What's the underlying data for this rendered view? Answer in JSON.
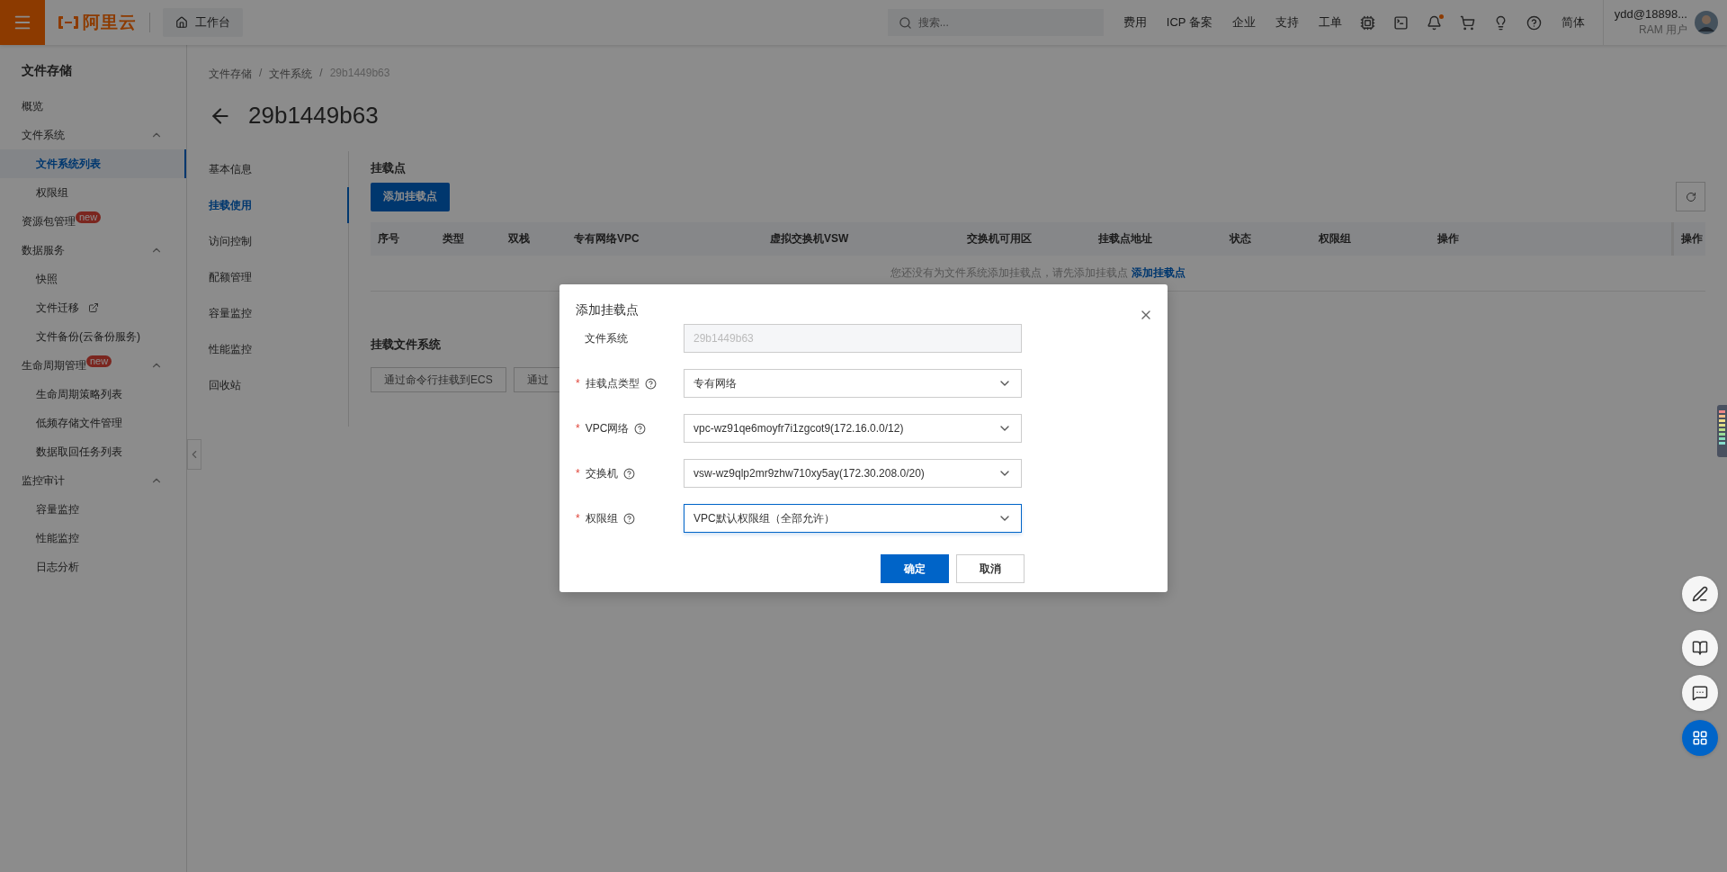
{
  "topbar": {
    "logo": "阿里云",
    "workbench": "工作台",
    "search": {
      "placeholder": "搜索..."
    },
    "links": [
      "费用",
      "ICP 备案",
      "企业",
      "支持",
      "工单"
    ],
    "language": "简体",
    "user": {
      "name": "ydd@18898...",
      "role": "RAM 用户"
    }
  },
  "sidebar": {
    "title": "文件存储",
    "items": [
      {
        "label": "概览",
        "selected": false
      },
      {
        "label": "文件系统",
        "selected": false,
        "expanded": true,
        "children": [
          {
            "label": "文件系统列表",
            "selected": true
          },
          {
            "label": "权限组",
            "selected": false
          }
        ]
      },
      {
        "label": "资源包管理",
        "selected": false,
        "badge": "new"
      },
      {
        "label": "数据服务",
        "selected": false,
        "expanded": true,
        "children": [
          {
            "label": "快照",
            "selected": false
          },
          {
            "label": "文件迁移",
            "selected": false,
            "external": true
          },
          {
            "label": "文件备份(云备份服务)",
            "selected": false
          }
        ]
      },
      {
        "label": "生命周期管理",
        "selected": false,
        "badge": "new",
        "expanded": true,
        "children": [
          {
            "label": "生命周期策略列表",
            "selected": false
          },
          {
            "label": "低频存储文件管理",
            "selected": false
          },
          {
            "label": "数据取回任务列表",
            "selected": false
          }
        ]
      },
      {
        "label": "监控审计",
        "selected": false,
        "expanded": true,
        "children": [
          {
            "label": "容量监控",
            "selected": false
          },
          {
            "label": "性能监控",
            "selected": false
          },
          {
            "label": "日志分析",
            "selected": false
          }
        ]
      }
    ]
  },
  "breadcrumb": [
    {
      "kind": "link",
      "text": "文件存储"
    },
    {
      "kind": "separator",
      "text": "/"
    },
    {
      "kind": "link",
      "text": "文件系统"
    },
    {
      "kind": "separator",
      "text": "/"
    },
    {
      "kind": "current",
      "text": "29b1449b63"
    }
  ],
  "page_title": "29b1449b63",
  "subnav": [
    {
      "label": "基本信息",
      "selected": false
    },
    {
      "label": "挂载使用",
      "selected": true
    },
    {
      "label": "访问控制",
      "selected": false
    },
    {
      "label": "配额管理",
      "selected": false
    },
    {
      "label": "容量监控",
      "selected": false
    },
    {
      "label": "性能监控",
      "selected": false
    },
    {
      "label": "回收站",
      "selected": false
    }
  ],
  "mount_points": {
    "title": "挂载点",
    "add_button": "添加挂载点",
    "table": {
      "columns": [
        "序号",
        "类型",
        "双栈",
        "专有网络VPC",
        "虚拟交换机VSW",
        "交换机可用区",
        "挂载点地址",
        "状态",
        "权限组",
        "操作"
      ],
      "fixed_column": "操作",
      "empty": {
        "text": "您还没有为文件系统添加挂载点，请先添加挂载点",
        "link": "添加挂载点"
      }
    }
  },
  "mount_fs": {
    "title": "挂载文件系统",
    "buttons": [
      "通过命令行挂载到ECS",
      "通过"
    ]
  },
  "dialog": {
    "title": "添加挂载点",
    "fields": [
      {
        "label": "文件系统",
        "help": false,
        "kind": "readonly",
        "value": "29b1449b63",
        "focused": false
      },
      {
        "required_mark": "*",
        "label": "挂载点类型",
        "help": true,
        "kind": "select",
        "value": "专有网络",
        "focused": false
      },
      {
        "required_mark": "*",
        "label": "VPC网络",
        "help": true,
        "kind": "select",
        "value": "vpc-wz91qe6moyfr7i1zgcot9(172.16.0.0/12)",
        "focused": false
      },
      {
        "required_mark": "*",
        "label": "交换机",
        "help": true,
        "kind": "select",
        "value": "vsw-wz9qlp2mr9zhw710xy5ay(172.30.208.0/20)",
        "focused": false
      },
      {
        "required_mark": "*",
        "label": "权限组",
        "help": true,
        "kind": "select",
        "value": "VPC默认权限组（全部允许）",
        "focused": true
      }
    ],
    "buttons": [
      {
        "label": "确定",
        "kind": "primary"
      },
      {
        "label": "取消",
        "kind": "default"
      }
    ]
  }
}
